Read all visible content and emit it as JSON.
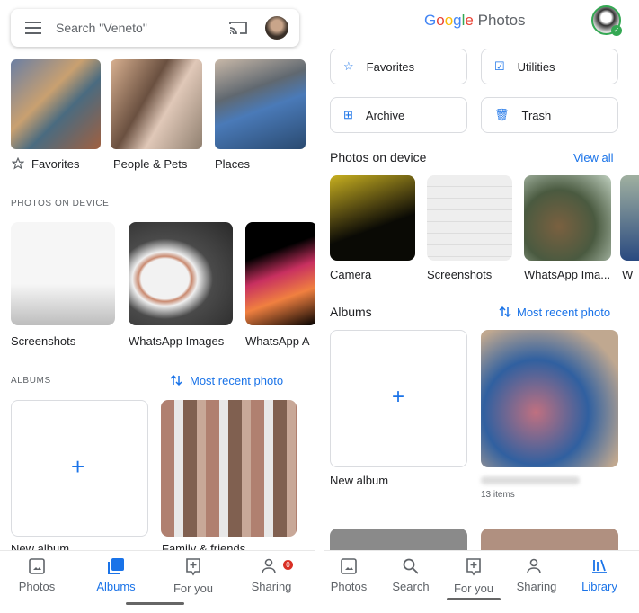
{
  "left": {
    "search_placeholder": "Search \"Veneto\"",
    "categories": [
      {
        "label": "Favorites"
      },
      {
        "label": "People & Pets"
      },
      {
        "label": "Places"
      }
    ],
    "device_heading": "PHOTOS ON DEVICE",
    "device_folders": [
      {
        "label": "Screenshots"
      },
      {
        "label": "WhatsApp Images"
      },
      {
        "label": "WhatsApp A"
      }
    ],
    "albums_heading": "ALBUMS",
    "sort_label": "Most recent photo",
    "albums": [
      {
        "label": "New album"
      },
      {
        "label": "Family & friends"
      }
    ],
    "nav": [
      {
        "label": "Photos"
      },
      {
        "label": "Albums",
        "active": true
      },
      {
        "label": "For you"
      },
      {
        "label": "Sharing",
        "badge": "0"
      }
    ]
  },
  "right": {
    "logo": "Google Photos",
    "buttons": [
      {
        "label": "Favorites",
        "icon": "star-icon"
      },
      {
        "label": "Utilities",
        "icon": "utilities-icon"
      },
      {
        "label": "Archive",
        "icon": "archive-icon"
      },
      {
        "label": "Trash",
        "icon": "trash-icon"
      }
    ],
    "device_heading": "Photos on device",
    "view_all": "View all",
    "device_folders": [
      {
        "label": "Camera"
      },
      {
        "label": "Screenshots"
      },
      {
        "label": "WhatsApp Ima..."
      },
      {
        "label": "W"
      }
    ],
    "albums_heading": "Albums",
    "sort_label": "Most recent photo",
    "albums": [
      {
        "label": "New album"
      },
      {
        "label": "",
        "count": "13 items"
      }
    ],
    "nav": [
      {
        "label": "Photos"
      },
      {
        "label": "Search"
      },
      {
        "label": "For you"
      },
      {
        "label": "Sharing"
      },
      {
        "label": "Library",
        "active": true
      }
    ]
  },
  "colors": {
    "accent": "#1a73e8",
    "badge": "#d93025"
  }
}
